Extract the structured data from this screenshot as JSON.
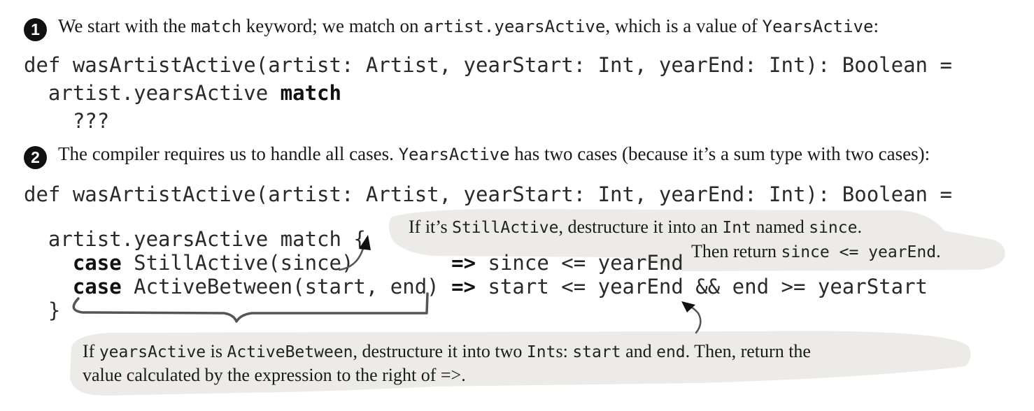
{
  "step1": {
    "number": "1",
    "text_1": "We start with the ",
    "code_1": "match",
    "text_2": " keyword; we match on ",
    "code_2": "artist.yearsActive",
    "text_3": ", which is a value of ",
    "code_3": "YearsActive",
    "text_4": ":"
  },
  "code1": {
    "line1": "def wasArtistActive(artist: Artist, yearStart: Int, yearEnd: Int): Boolean =",
    "line2_prefix": "  artist.yearsActive ",
    "line2_keyword": "match",
    "line3": "    ???"
  },
  "step2": {
    "number": "2",
    "text_1": "The compiler requires us to handle all cases. ",
    "code_1": "YearsActive",
    "text_2": " has two cases (because it’s a sum type with two cases):"
  },
  "code2": {
    "line1": "def wasArtistActive(artist: Artist, yearStart: Int, yearEnd: Int): Boolean =",
    "line2": "  artist.yearsActive match {",
    "case_kw": "case",
    "case1_pattern": " StillActive(since)",
    "case1_arrow": "=>",
    "case1_expr": " since <= yearEnd",
    "case2_pattern": " ActiveBetween(start, end) ",
    "case2_arrow": "=>",
    "case2_expr": " start <= yearEnd && end >= yearStart",
    "closing": "  }"
  },
  "note_top": {
    "line1_text_1": "If it’s ",
    "line1_code_1": "StillActive",
    "line1_text_2": ", destructure it into an ",
    "line1_code_2": "Int",
    "line1_text_3": " named ",
    "line1_code_3": "since",
    "line1_text_4": ".",
    "line2_text_1": "Then return ",
    "line2_code_1": "since <= yearEnd",
    "line2_text_2": "."
  },
  "note_bottom": {
    "line1_text_1": "If ",
    "line1_code_1": "yearsActive",
    "line1_text_2": " is ",
    "line1_code_2": "ActiveBetween",
    "line1_text_3": ", destructure it into two ",
    "line1_code_3": "Int",
    "line1_text_4": "s: ",
    "line1_code_4": "start",
    "line1_text_5": " and ",
    "line1_code_5": "end",
    "line1_text_6": ". Then, return the",
    "line2_text_1": "value calculated by the expression to the right of =>."
  },
  "colors": {
    "callout_fill": "#ecebe8",
    "annotation_stroke": "#555555",
    "step_badge": "#111111"
  }
}
